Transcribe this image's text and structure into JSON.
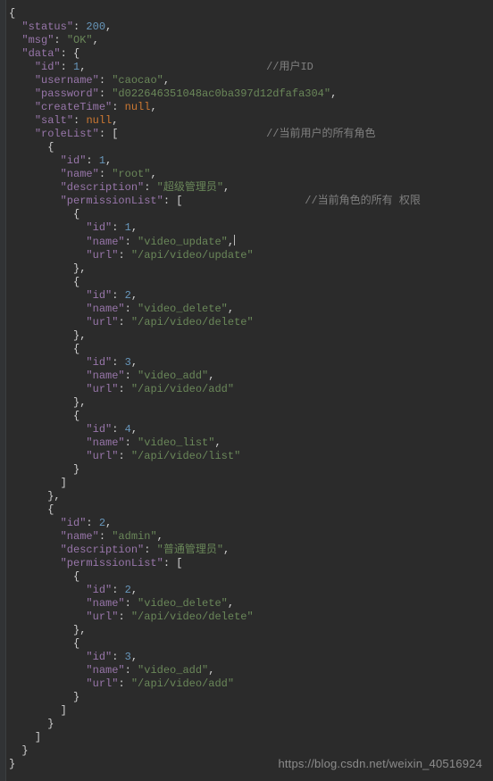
{
  "code": {
    "lines": [
      {
        "indent": 0,
        "open": "{"
      },
      {
        "indent": 2,
        "key": "status",
        "num": "200",
        "comma": true
      },
      {
        "indent": 2,
        "key": "msg",
        "str": "OK",
        "comma": true
      },
      {
        "indent": 2,
        "key": "data",
        "open": "{"
      },
      {
        "indent": 4,
        "key": "id",
        "num": "1",
        "comma": true,
        "comment": "//用户ID",
        "commentCol": 40
      },
      {
        "indent": 4,
        "key": "username",
        "str": "caocao",
        "comma": true
      },
      {
        "indent": 4,
        "key": "password",
        "str": "d022646351048ac0ba397d12dfafa304",
        "comma": true
      },
      {
        "indent": 4,
        "key": "createTime",
        "kw": "null",
        "comma": true
      },
      {
        "indent": 4,
        "key": "salt",
        "kw": "null",
        "comma": true
      },
      {
        "indent": 4,
        "key": "roleList",
        "open": "[",
        "comment": "//当前用户的所有角色",
        "commentCol": 40
      },
      {
        "indent": 6,
        "open": "{"
      },
      {
        "indent": 8,
        "key": "id",
        "num": "1",
        "comma": true
      },
      {
        "indent": 8,
        "key": "name",
        "str": "root",
        "comma": true
      },
      {
        "indent": 8,
        "key": "description",
        "str": "超级管理员",
        "comma": true
      },
      {
        "indent": 8,
        "key": "permissionList",
        "open": "[",
        "comment": "//当前角色的所有 权限",
        "commentCol": 46
      },
      {
        "indent": 10,
        "open": "{"
      },
      {
        "indent": 12,
        "key": "id",
        "num": "1",
        "comma": true
      },
      {
        "indent": 12,
        "key": "name",
        "str": "video_update",
        "comma": true,
        "cursor": true
      },
      {
        "indent": 12,
        "key": "url",
        "str": "/api/video/update"
      },
      {
        "indent": 10,
        "close": "}",
        "comma": true
      },
      {
        "indent": 10,
        "open": "{"
      },
      {
        "indent": 12,
        "key": "id",
        "num": "2",
        "comma": true
      },
      {
        "indent": 12,
        "key": "name",
        "str": "video_delete",
        "comma": true
      },
      {
        "indent": 12,
        "key": "url",
        "str": "/api/video/delete"
      },
      {
        "indent": 10,
        "close": "}",
        "comma": true
      },
      {
        "indent": 10,
        "open": "{"
      },
      {
        "indent": 12,
        "key": "id",
        "num": "3",
        "comma": true
      },
      {
        "indent": 12,
        "key": "name",
        "str": "video_add",
        "comma": true
      },
      {
        "indent": 12,
        "key": "url",
        "str": "/api/video/add"
      },
      {
        "indent": 10,
        "close": "}",
        "comma": true
      },
      {
        "indent": 10,
        "open": "{"
      },
      {
        "indent": 12,
        "key": "id",
        "num": "4",
        "comma": true
      },
      {
        "indent": 12,
        "key": "name",
        "str": "video_list",
        "comma": true
      },
      {
        "indent": 12,
        "key": "url",
        "str": "/api/video/list"
      },
      {
        "indent": 10,
        "close": "}"
      },
      {
        "indent": 8,
        "close": "]"
      },
      {
        "indent": 6,
        "close": "}",
        "comma": true
      },
      {
        "indent": 6,
        "open": "{"
      },
      {
        "indent": 8,
        "key": "id",
        "num": "2",
        "comma": true
      },
      {
        "indent": 8,
        "key": "name",
        "str": "admin",
        "comma": true
      },
      {
        "indent": 8,
        "key": "description",
        "str": "普通管理员",
        "comma": true
      },
      {
        "indent": 8,
        "key": "permissionList",
        "open": "["
      },
      {
        "indent": 10,
        "open": "{"
      },
      {
        "indent": 12,
        "key": "id",
        "num": "2",
        "comma": true
      },
      {
        "indent": 12,
        "key": "name",
        "str": "video_delete",
        "comma": true
      },
      {
        "indent": 12,
        "key": "url",
        "str": "/api/video/delete"
      },
      {
        "indent": 10,
        "close": "}",
        "comma": true
      },
      {
        "indent": 10,
        "open": "{"
      },
      {
        "indent": 12,
        "key": "id",
        "num": "3",
        "comma": true
      },
      {
        "indent": 12,
        "key": "name",
        "str": "video_add",
        "comma": true
      },
      {
        "indent": 12,
        "key": "url",
        "str": "/api/video/add"
      },
      {
        "indent": 10,
        "close": "}"
      },
      {
        "indent": 8,
        "close": "]"
      },
      {
        "indent": 6,
        "close": "}"
      },
      {
        "indent": 4,
        "close": "]"
      },
      {
        "indent": 2,
        "close": "}"
      },
      {
        "indent": 0,
        "close": "}"
      }
    ]
  },
  "watermark": "https://blog.csdn.net/weixin_40516924"
}
